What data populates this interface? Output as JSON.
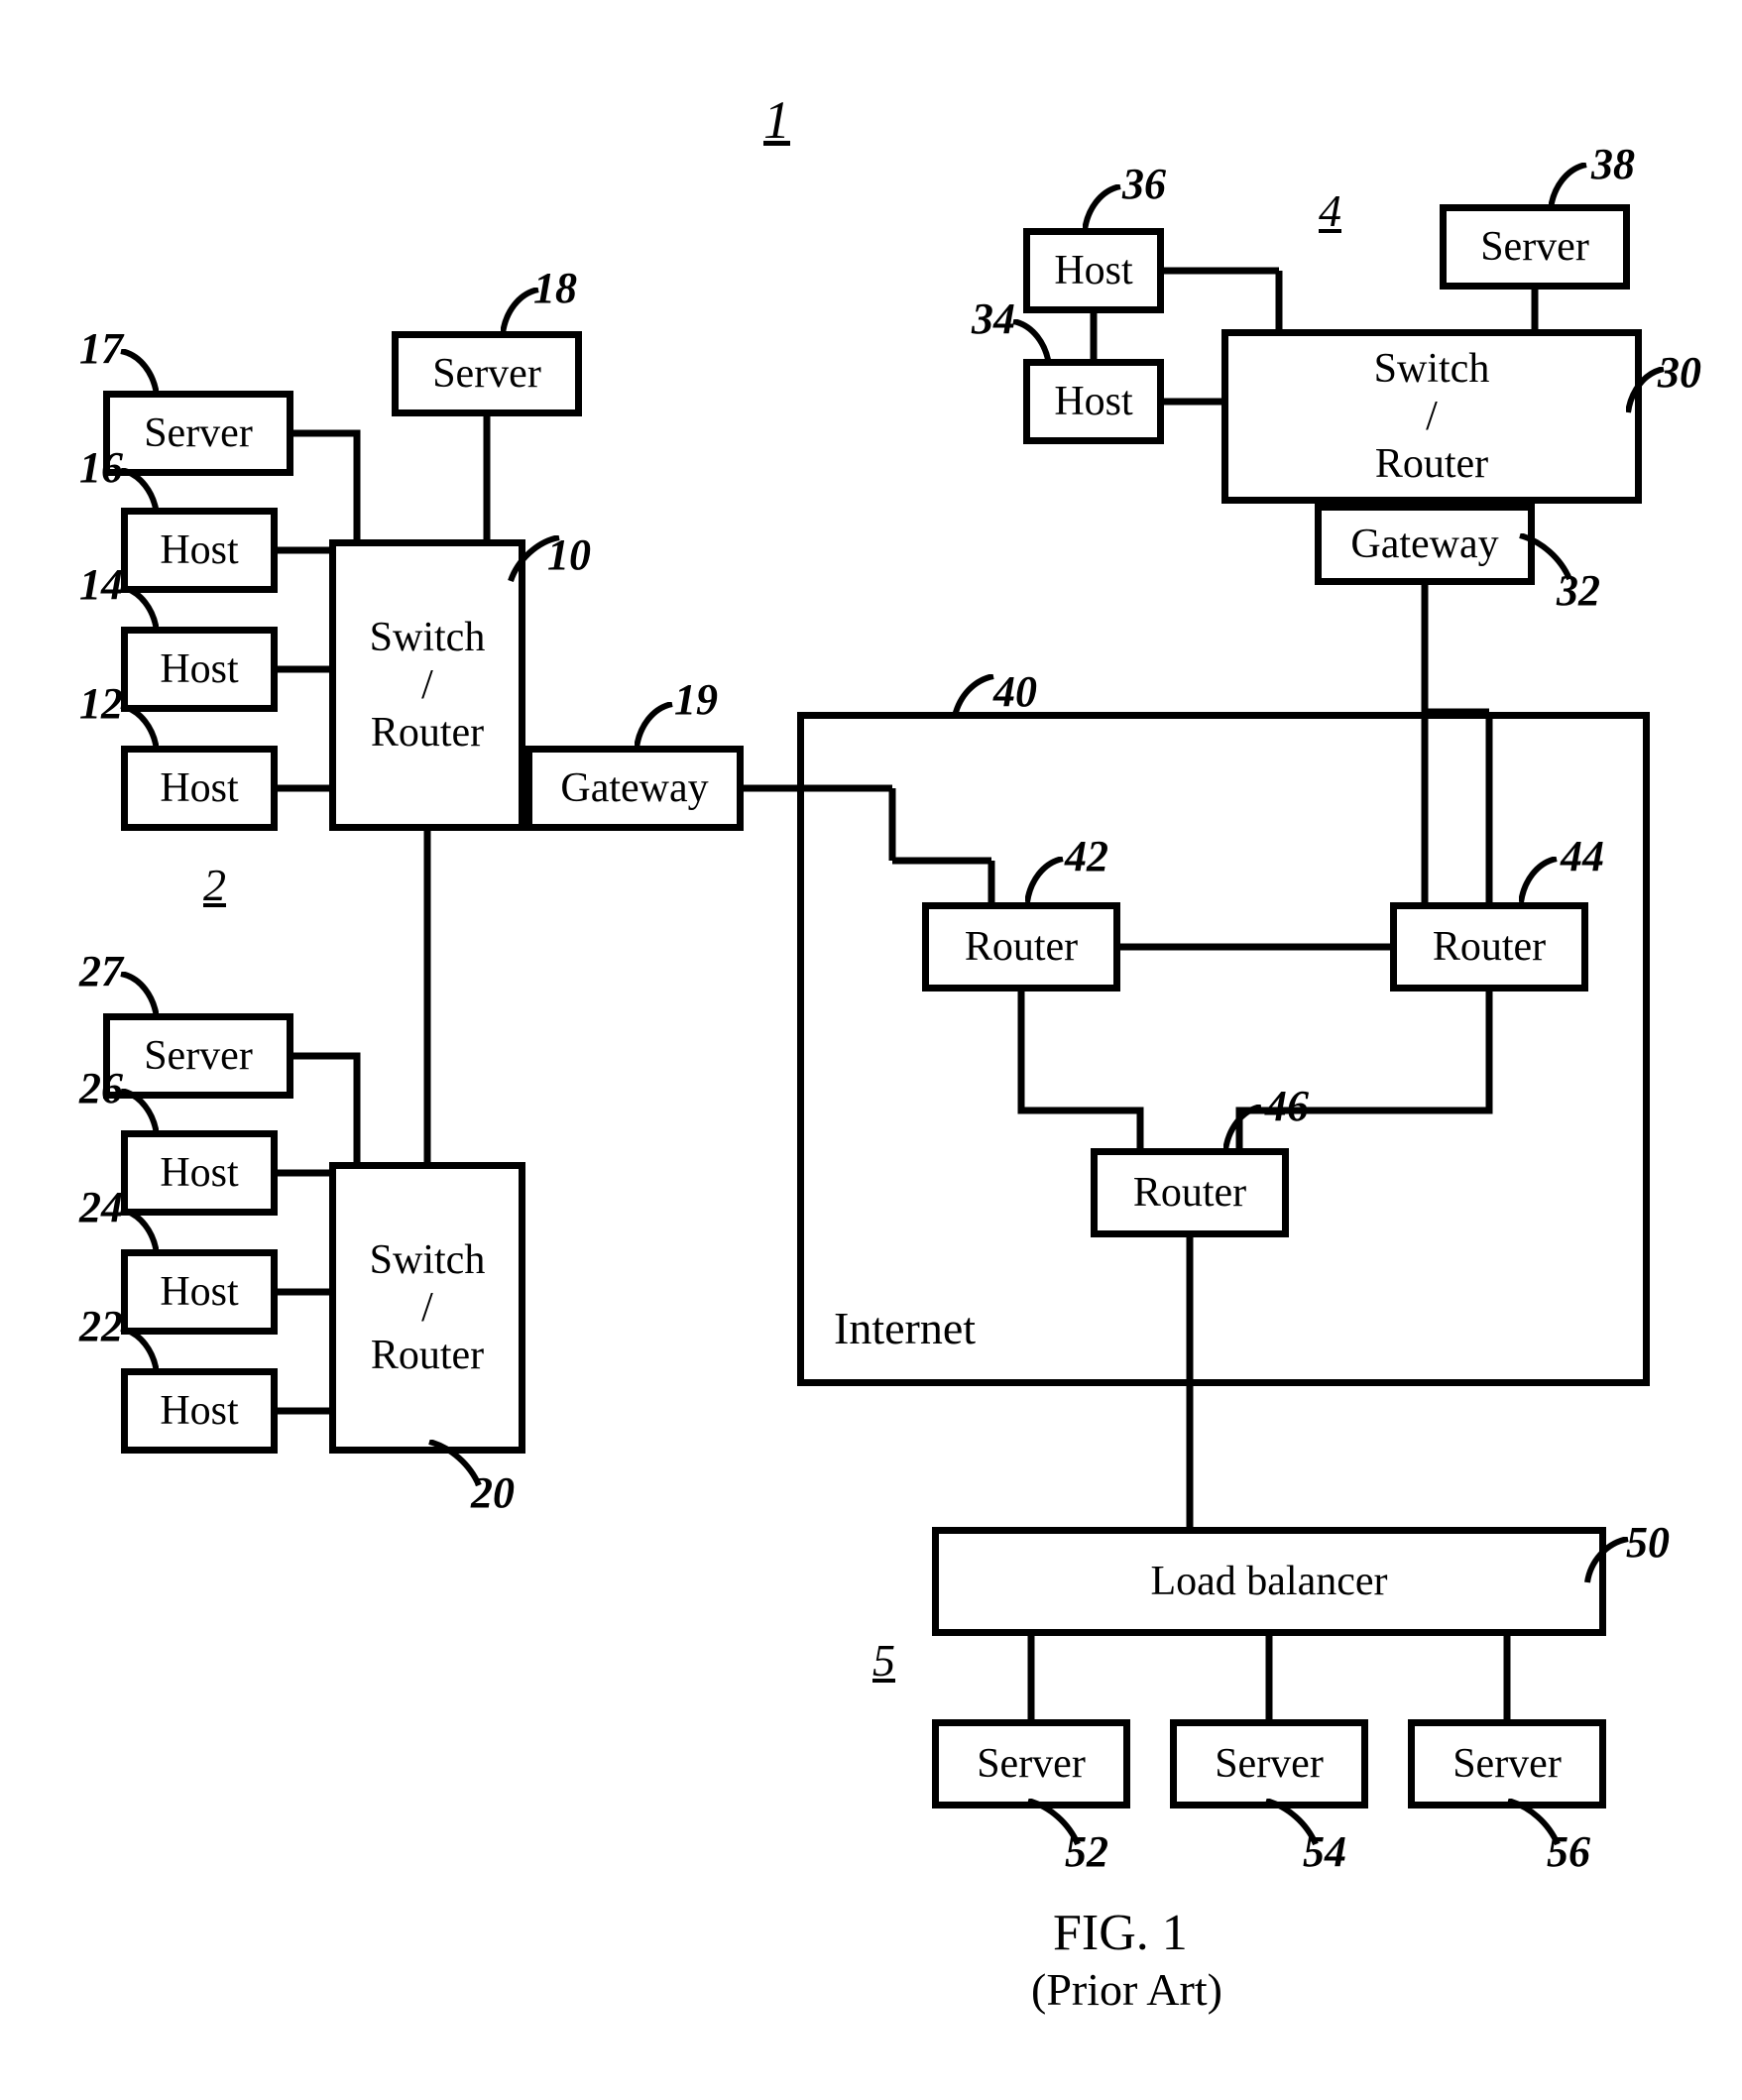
{
  "figure": {
    "number_label": "1",
    "caption_line1": "FIG. 1",
    "caption_line2": "(Prior Art)"
  },
  "regions": {
    "r2": "2",
    "r4": "4",
    "r5": "5"
  },
  "nodes": {
    "server18": "Server",
    "server17": "Server",
    "host16": "Host",
    "host14": "Host",
    "host12": "Host",
    "switch10": "Switch\n/\nRouter",
    "gateway19": "Gateway",
    "server27": "Server",
    "host26": "Host",
    "host24": "Host",
    "host22": "Host",
    "switch20": "Switch\n/\nRouter",
    "host36": "Host",
    "host34": "Host",
    "server38": "Server",
    "switch30": "Switch\n/\nRouter",
    "gateway32": "Gateway",
    "internet_box_label": "Internet",
    "router42": "Router",
    "router44": "Router",
    "router46": "Router",
    "loadbalancer50": "Load balancer",
    "server52": "Server",
    "server54": "Server",
    "server56": "Server"
  },
  "refnums": {
    "n1": "1",
    "n4": "4",
    "n17": "17",
    "n18": "18",
    "n16": "16",
    "n14": "14",
    "n12": "12",
    "n10": "10",
    "n19": "19",
    "n2": "2",
    "n27": "27",
    "n26": "26",
    "n24": "24",
    "n22": "22",
    "n20": "20",
    "n36": "36",
    "n34": "34",
    "n38": "38",
    "n30": "30",
    "n32": "32",
    "n40": "40",
    "n42": "42",
    "n44": "44",
    "n46": "46",
    "n50": "50",
    "n5": "5",
    "n52": "52",
    "n54": "54",
    "n56": "56"
  }
}
